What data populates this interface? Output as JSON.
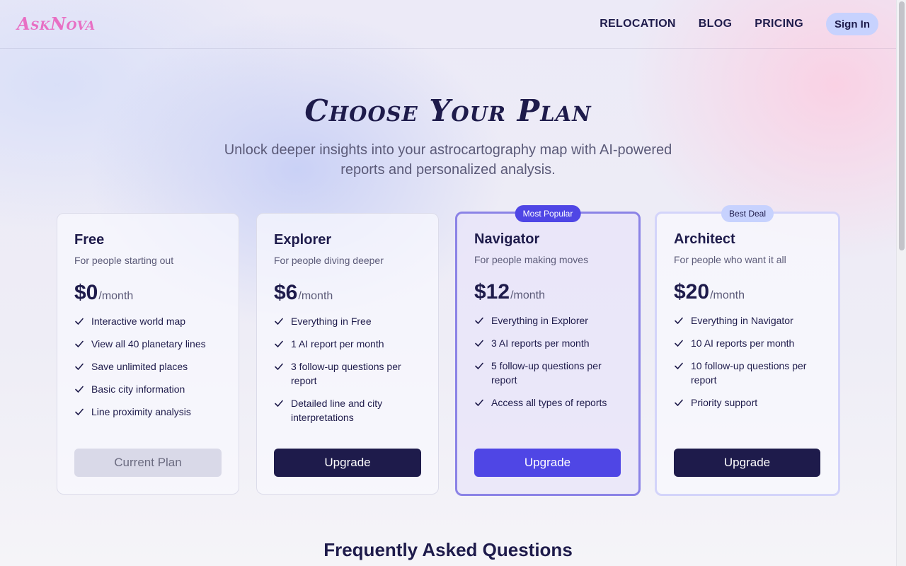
{
  "header": {
    "logo": "AskNova",
    "nav": [
      "RELOCATION",
      "BLOG",
      "PRICING"
    ],
    "signin": "Sign In"
  },
  "hero": {
    "title": "Choose Your Plan",
    "subtitle": "Unlock deeper insights into your astrocartography map with AI-powered reports and personalized analysis."
  },
  "plans": [
    {
      "name": "Free",
      "description": "For people starting out",
      "price": "$0",
      "period": "/month",
      "badge": "",
      "features": [
        "Interactive world map",
        "View all 40 planetary lines",
        "Save unlimited places",
        "Basic city information",
        "Line proximity analysis"
      ],
      "button": "Current Plan"
    },
    {
      "name": "Explorer",
      "description": "For people diving deeper",
      "price": "$6",
      "period": "/month",
      "badge": "",
      "features": [
        "Everything in Free",
        "1 AI report per month",
        "3 follow-up questions per report",
        "Detailed line and city interpretations"
      ],
      "button": "Upgrade"
    },
    {
      "name": "Navigator",
      "description": "For people making moves",
      "price": "$12",
      "period": "/month",
      "badge": "Most Popular",
      "features": [
        "Everything in Explorer",
        "3 AI reports per month",
        "5 follow-up questions per report",
        "Access all types of reports"
      ],
      "button": "Upgrade"
    },
    {
      "name": "Architect",
      "description": "For people who want it all",
      "price": "$20",
      "period": "/month",
      "badge": "Best Deal",
      "features": [
        "Everything in Navigator",
        "10 AI reports per month",
        "10 follow-up questions per report",
        "Priority support"
      ],
      "button": "Upgrade"
    }
  ],
  "faq": {
    "title": "Frequently Asked Questions"
  },
  "colors": {
    "brand": "#e86fc4",
    "primary": "#4f46e5",
    "dark": "#1e1b4b",
    "badge_light": "#c7d2fe"
  }
}
